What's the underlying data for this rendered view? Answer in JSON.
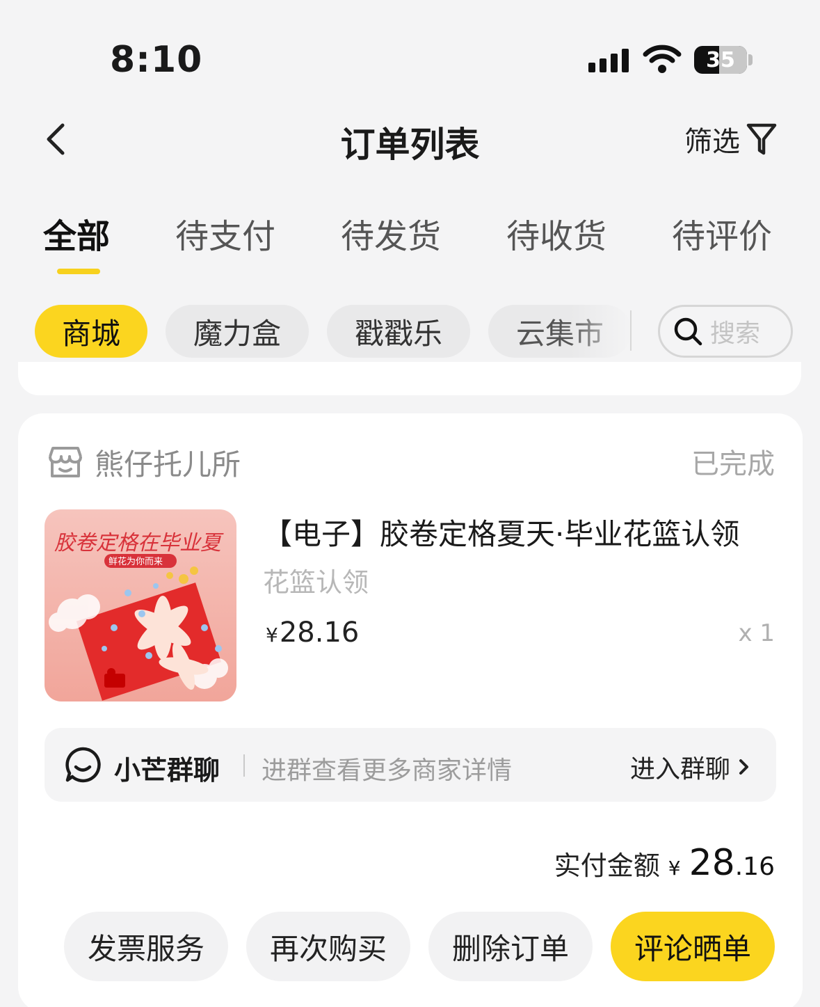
{
  "status_bar": {
    "time": "8:10",
    "battery": "35"
  },
  "header": {
    "title": "订单列表",
    "filter_label": "筛选"
  },
  "tabs": [
    {
      "label": "全部",
      "active": true
    },
    {
      "label": "待支付",
      "active": false
    },
    {
      "label": "待发货",
      "active": false
    },
    {
      "label": "待收货",
      "active": false
    },
    {
      "label": "待评价",
      "active": false
    }
  ],
  "chips": [
    {
      "label": "商城",
      "active": true
    },
    {
      "label": "魔力盒",
      "active": false
    },
    {
      "label": "戳戳乐",
      "active": false
    },
    {
      "label": "云集市",
      "active": false
    }
  ],
  "search": {
    "placeholder": "搜索"
  },
  "order": {
    "shop_name": "熊仔托儿所",
    "status": "已完成",
    "product": {
      "title": "【电子】胶卷定格夏天·毕业花篮认领",
      "spec": "花篮认领",
      "price_symbol": "¥",
      "price": "28.16",
      "quantity": "x 1",
      "thumb_title": "胶卷定格在毕业夏",
      "thumb_subtitle": "鲜花为你而来"
    },
    "chat": {
      "name": "小芒群聊",
      "description": "进群查看更多商家详情",
      "enter_label": "进入群聊"
    },
    "total": {
      "label": "实付金额",
      "symbol": "¥",
      "integer": "28",
      "decimal": ".16"
    },
    "actions": [
      {
        "label": "发票服务",
        "primary": false
      },
      {
        "label": "再次购买",
        "primary": false
      },
      {
        "label": "删除订单",
        "primary": false
      },
      {
        "label": "评论晒单",
        "primary": true
      }
    ]
  },
  "colors": {
    "accent": "#fbd51f",
    "background": "#f4f4f5",
    "card": "#ffffff"
  }
}
